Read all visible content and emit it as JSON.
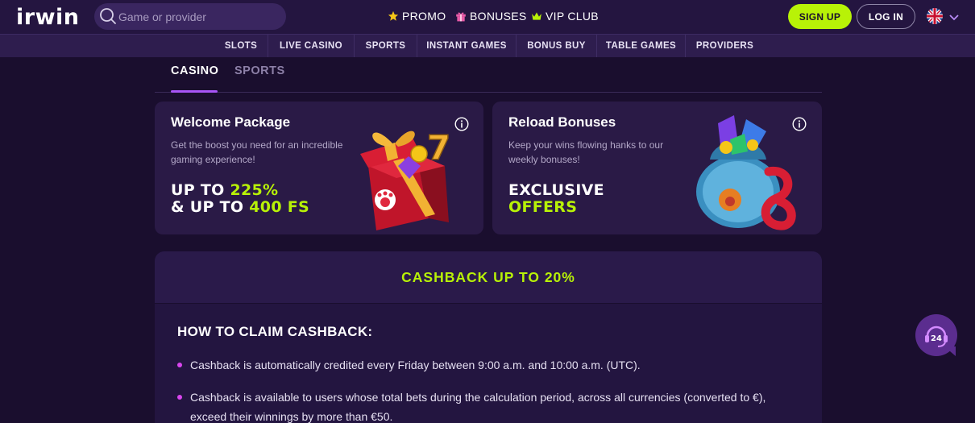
{
  "header": {
    "logo": "irwin",
    "search_placeholder": "Game or provider",
    "nav": [
      {
        "label": "PROMO",
        "icon": "star-icon"
      },
      {
        "label": "BONUSES",
        "icon": "gift-icon"
      },
      {
        "label": "VIP CLUB",
        "icon": "crown-icon"
      }
    ],
    "signup_label": "SIGN UP",
    "login_label": "LOG IN",
    "language_icon": "uk-flag-icon"
  },
  "categories": [
    "SLOTS",
    "LIVE CASINO",
    "SPORTS",
    "INSTANT GAMES",
    "BONUS BUY",
    "TABLE GAMES",
    "PROVIDERS"
  ],
  "tabs": [
    {
      "label": "CASINO",
      "active": true
    },
    {
      "label": "SPORTS",
      "active": false
    }
  ],
  "cards": [
    {
      "title": "Welcome Package",
      "description": "Get the boost you need for an incredible gaming experience!",
      "line1_prefix": "UP TO ",
      "line1_highlight": "225%",
      "line2_prefix": "& UP TO ",
      "line2_highlight": "400 FS"
    },
    {
      "title": "Reload Bonuses",
      "description": "Keep your wins flowing hanks to our weekly bonuses!",
      "line1": "EXCLUSIVE",
      "line2": "OFFERS"
    }
  ],
  "cashback": {
    "heading": "CASHBACK UP TO 20%",
    "how_title": "HOW TO CLAIM CASHBACK:",
    "bullets": [
      "Cashback is automatically credited every Friday between 9:00 a.m. and 10:00 a.m. (UTC).",
      "Cashback is available to users whose total bets during the calculation period, across all currencies (converted to €), exceed their winnings by more than €50."
    ]
  },
  "support_badge": "24",
  "colors": {
    "background": "#1a0e2e",
    "header": "#241540",
    "accent_lime": "#b8f207",
    "accent_purple": "#a855f7",
    "bullet_magenta": "#d946ef"
  }
}
